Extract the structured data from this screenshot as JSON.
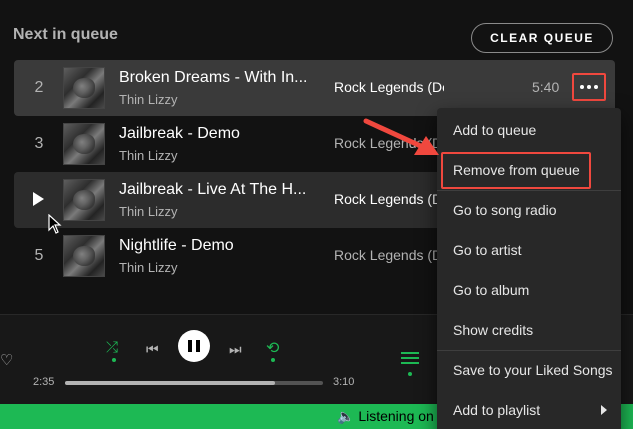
{
  "queue": {
    "title": "Next in queue",
    "clear_label": "CLEAR QUEUE",
    "rows": [
      {
        "num": "2",
        "title": "Broken Dreams - With In...",
        "artist": "Thin Lizzy",
        "album": "Rock Legends (De...",
        "duration": "5:40"
      },
      {
        "num": "3",
        "title": "Jailbreak - Demo",
        "artist": "Thin Lizzy",
        "album": "Rock Legends (De..."
      },
      {
        "num": "",
        "title": "Jailbreak - Live At The H...",
        "artist": "Thin Lizzy",
        "album": "Rock Legends (De..."
      },
      {
        "num": "5",
        "title": "Nightlife - Demo",
        "artist": "Thin Lizzy",
        "album": "Rock Legends (De..."
      }
    ]
  },
  "player": {
    "elapsed": "2:35",
    "total": "3:10",
    "progress": 0.815
  },
  "status": {
    "listening": "Listening on"
  },
  "menu": {
    "items": [
      "Add to queue",
      "Remove from queue",
      "Go to song radio",
      "Go to artist",
      "Go to album",
      "Show credits",
      "Save to your Liked Songs",
      "Add to playlist"
    ]
  },
  "colors": {
    "accent": "#1db954",
    "annotation": "#f0483e",
    "background": "#121212"
  },
  "icons": [
    "more-icon",
    "play-icon",
    "heart-icon",
    "shuffle-icon",
    "previous-icon",
    "pause-icon",
    "next-icon",
    "repeat-icon",
    "queue-icon",
    "speaker-icon",
    "chevron-right-icon",
    "cursor-icon"
  ]
}
